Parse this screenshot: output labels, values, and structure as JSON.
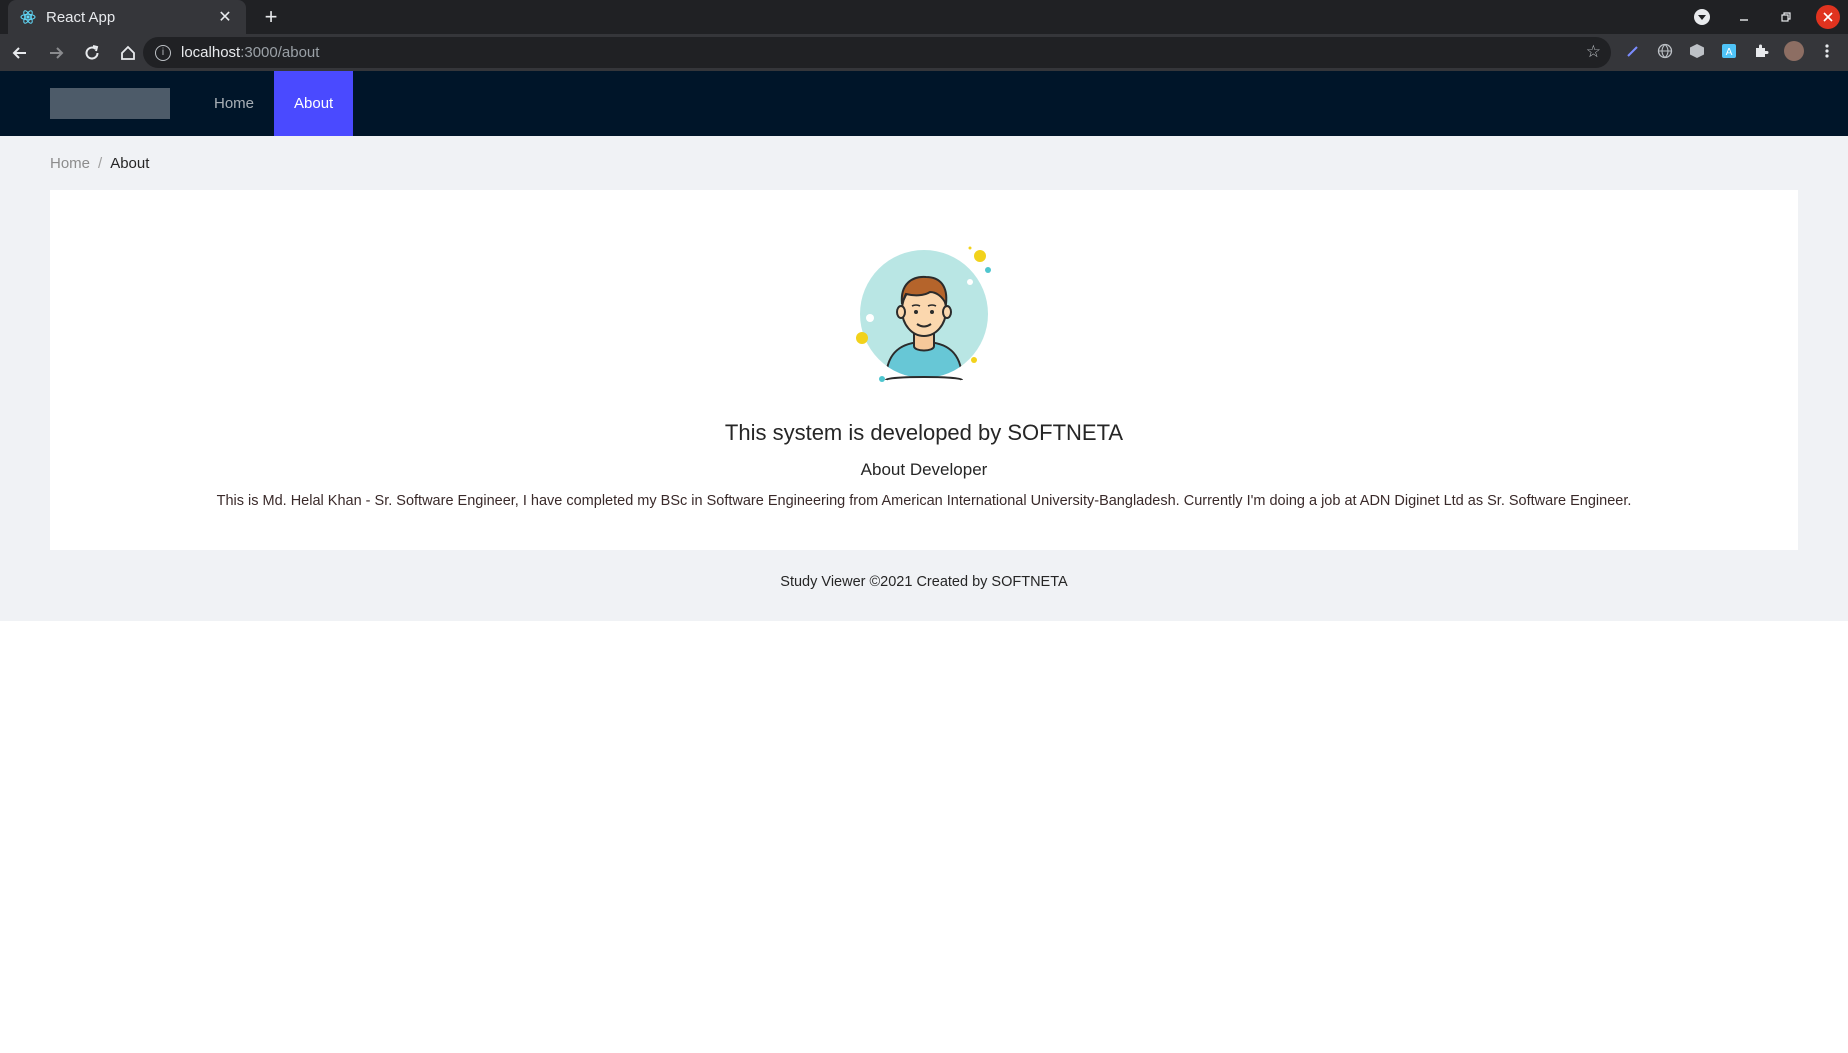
{
  "browser": {
    "tab_title": "React App",
    "tab_close": "✕",
    "new_tab": "+",
    "url_host": "localhost",
    "url_path": ":3000/about",
    "icons": [
      "react-icon",
      "back-icon",
      "forward-icon",
      "reload-icon",
      "home-icon",
      "info-icon",
      "star-icon",
      "extension-icon",
      "profile-avatar"
    ]
  },
  "header": {
    "menu": [
      {
        "label": "Home",
        "active": false
      },
      {
        "label": "About",
        "active": true
      }
    ]
  },
  "breadcrumb": {
    "home": "Home",
    "separator": "/",
    "current": "About"
  },
  "content": {
    "headline": "This system is developed by SOFTNETA",
    "subheading": "About Developer",
    "description": "This is Md. Helal Khan - Sr. Software Engineer, I have completed my BSc in Software Engineering from American International University-Bangladesh. Currently I'm doing a job at ADN Diginet Ltd as Sr. Software Engineer."
  },
  "footer": {
    "text": "Study Viewer ©2021 Created by SOFTNETA"
  },
  "colors": {
    "header_bg": "#001529",
    "active_menu": "#4a4aff",
    "page_bg": "#f0f2f5"
  }
}
